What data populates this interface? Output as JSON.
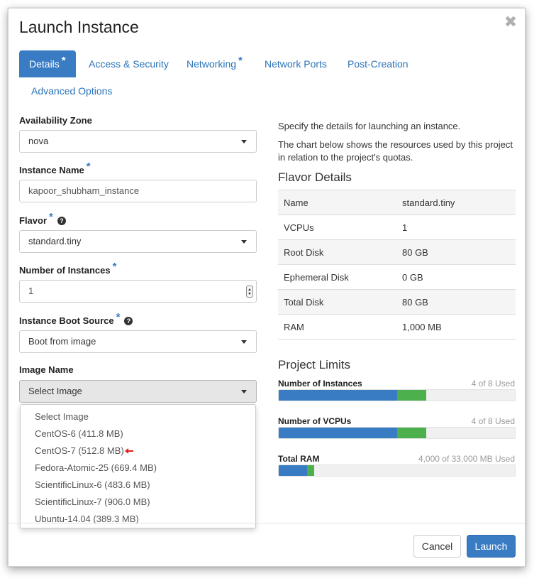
{
  "dialog": {
    "title": "Launch Instance",
    "close_glyph": "✖"
  },
  "tabs": [
    {
      "label": "Details",
      "required": "*",
      "active": true
    },
    {
      "label": "Access & Security",
      "required": "",
      "active": false
    },
    {
      "label": "Networking",
      "required": "*",
      "active": false
    },
    {
      "label": "Network Ports",
      "required": "",
      "active": false
    },
    {
      "label": "Post-Creation",
      "required": "",
      "active": false
    },
    {
      "label": "Advanced Options",
      "required": "",
      "active": false
    }
  ],
  "form": {
    "availability_zone": {
      "label": "Availability Zone",
      "value": "nova"
    },
    "instance_name": {
      "label": "Instance Name",
      "required": "*",
      "value": "kapoor_shubham_instance"
    },
    "flavor": {
      "label": "Flavor",
      "required": "*",
      "help": "?",
      "value": "standard.tiny"
    },
    "number_of_instances": {
      "label": "Number of Instances",
      "required": "*",
      "value": "1"
    },
    "boot_source": {
      "label": "Instance Boot Source",
      "required": "*",
      "help": "?",
      "value": "Boot from image"
    },
    "image_name": {
      "label": "Image Name",
      "value": "Select Image"
    }
  },
  "image_options": [
    "Select Image",
    "CentOS-6 (411.8 MB)",
    "CentOS-7 (512.8 MB)",
    "Fedora-Atomic-25 (669.4 MB)",
    "ScientificLinux-6 (483.6 MB)",
    "ScientificLinux-7 (906.0 MB)",
    "Ubuntu-14.04 (389.3 MB)"
  ],
  "highlighted_option_icon": "red-arrow-icon",
  "info": {
    "intro": "Specify the details for launching an instance.",
    "chart_note": "The chart below shows the resources used by this project in relation to the project's quotas."
  },
  "flavor_details": {
    "title": "Flavor Details",
    "rows": [
      {
        "key": "Name",
        "value": "standard.tiny"
      },
      {
        "key": "VCPUs",
        "value": "1"
      },
      {
        "key": "Root Disk",
        "value": "80 GB"
      },
      {
        "key": "Ephemeral Disk",
        "value": "0 GB"
      },
      {
        "key": "Total Disk",
        "value": "80 GB"
      },
      {
        "key": "RAM",
        "value": "1,000 MB"
      }
    ]
  },
  "project_limits": {
    "title": "Project Limits",
    "items": [
      {
        "label": "Number of Instances",
        "used_text": "4 of 8 Used",
        "used": 4,
        "added": 1,
        "total": 8
      },
      {
        "label": "Number of VCPUs",
        "used_text": "4 of 8 Used",
        "used": 4,
        "added": 1,
        "total": 8
      },
      {
        "label": "Total RAM",
        "used_text": "4,000 of 33,000 MB Used",
        "used": 4000,
        "added": 1000,
        "total": 33000
      }
    ]
  },
  "footer": {
    "cancel_label": "Cancel",
    "launch_label": "Launch"
  },
  "colors": {
    "primary": "#3a7cc4",
    "quota_added": "#4cb04c",
    "link": "#2a73b9",
    "arrow": "#e02020"
  }
}
